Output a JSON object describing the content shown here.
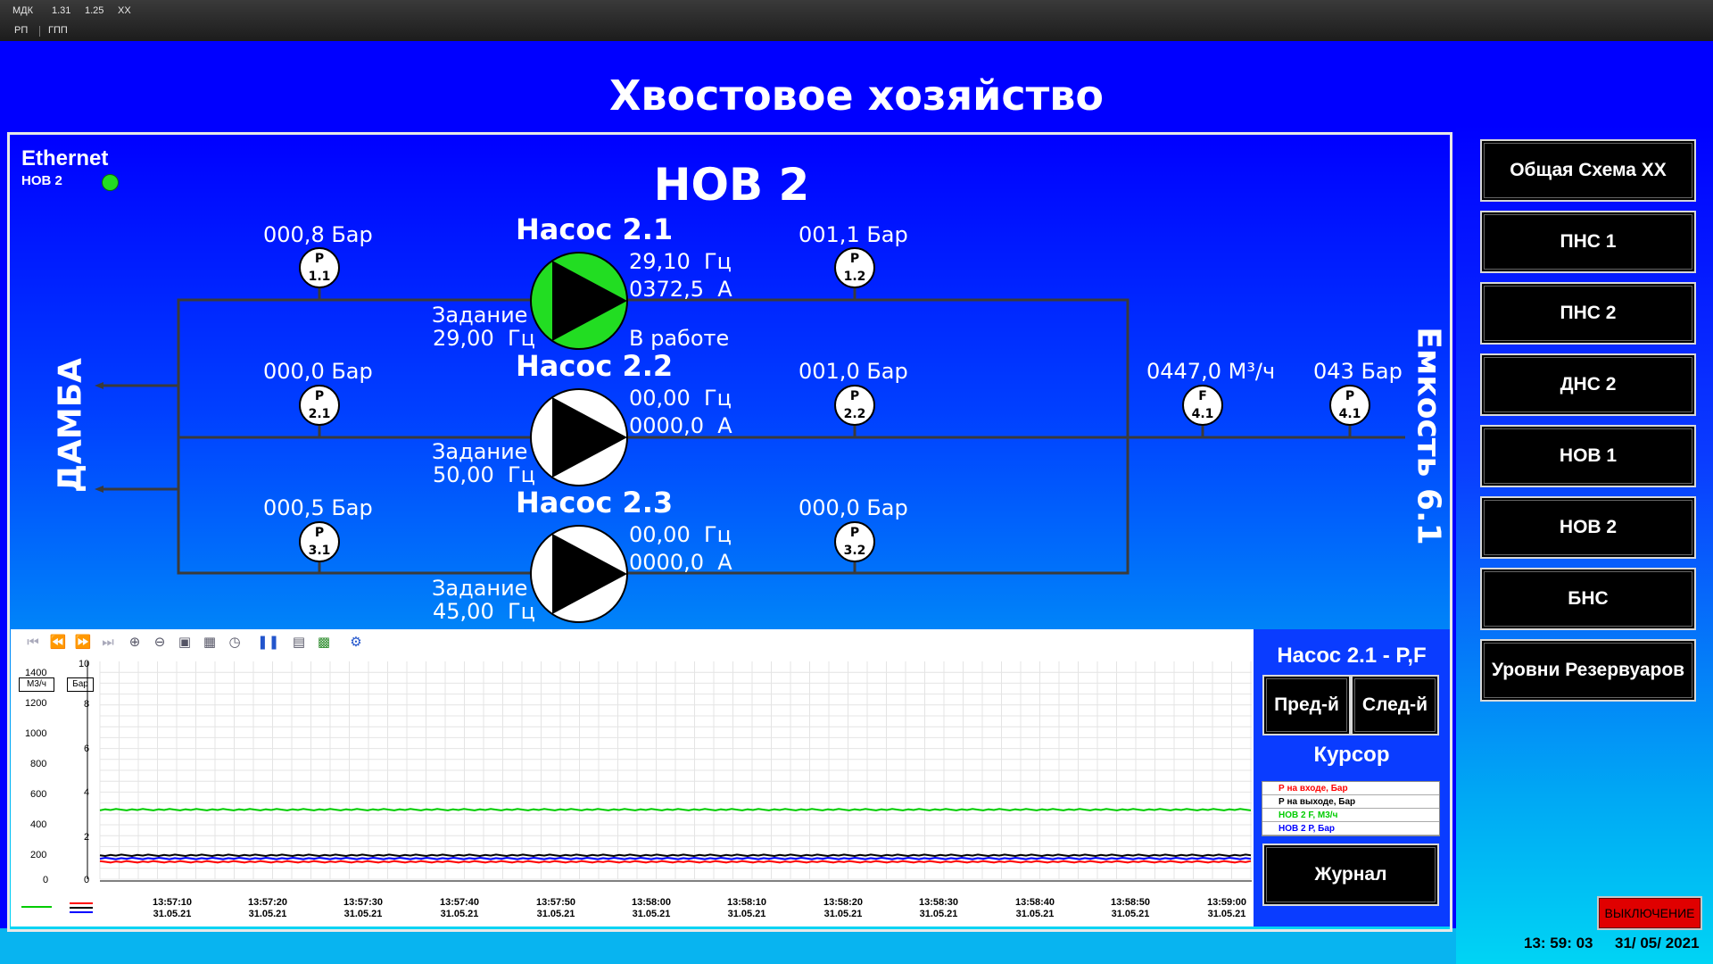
{
  "menubar": {
    "row1": [
      "МДК",
      "1.31",
      "1.25",
      "ХХ"
    ],
    "row2": [
      "РП",
      "ГПП"
    ]
  },
  "title": "Хвостовое хозяйство",
  "comm": {
    "label": "Ethernet",
    "node": "НОВ 2",
    "status_color": "#22dd22"
  },
  "station_title": "НОВ 2",
  "left_label": "ДАМБА",
  "right_label": "Емкость 6.1",
  "pumps": [
    {
      "name": "Насос 2.1",
      "freq": "29,10  Гц",
      "current": "0372,5  А",
      "setpoint_label": "Задание",
      "setpoint": "29,00  Гц",
      "state": "В работе",
      "running": true
    },
    {
      "name": "Насос 2.2",
      "freq": "00,00  Гц",
      "current": "0000,0  А",
      "setpoint_label": "Задание",
      "setpoint": "50,00  Гц",
      "state": "",
      "running": false
    },
    {
      "name": "Насос 2.3",
      "freq": "00,00  Гц",
      "current": "0000,0  А",
      "setpoint_label": "Задание",
      "setpoint": "45,00  Гц",
      "state": "",
      "running": false
    }
  ],
  "sensors": {
    "p11": {
      "letter": "P",
      "id": "1.1",
      "value": "000,8 Бар"
    },
    "p12": {
      "letter": "P",
      "id": "1.2",
      "value": "001,1 Бар"
    },
    "p21": {
      "letter": "P",
      "id": "2.1",
      "value": "000,0 Бар"
    },
    "p22": {
      "letter": "P",
      "id": "2.2",
      "value": "001,0 Бар"
    },
    "p31": {
      "letter": "P",
      "id": "3.1",
      "value": "000,5 Бар"
    },
    "p32": {
      "letter": "P",
      "id": "3.2",
      "value": "000,0 Бар"
    },
    "f41": {
      "letter": "F",
      "id": "4.1",
      "value": "0447,0 М³/ч"
    },
    "p41": {
      "letter": "P",
      "id": "4.1",
      "value": "043 Бар"
    }
  },
  "nav": [
    "Общая Схема ХХ",
    "ПНС 1",
    "ПНС 2",
    "ДНС 2",
    "НОВ 1",
    "НОВ 2",
    "БНС",
    "Уровни Резервуаров"
  ],
  "chart_panel": {
    "title": "Насос 2.1 - P,F",
    "prev": "Пред-й",
    "next": "След-й",
    "cursor": "Курсор",
    "journal": "Журнал",
    "legend": [
      {
        "label": "Р на входе, Бар",
        "color": "#ff0000"
      },
      {
        "label": "Р на выходе, Бар",
        "color": "#000000"
      },
      {
        "label": "НОВ 2 F, М3/ч",
        "color": "#00cc00"
      },
      {
        "label": "НОВ 2 Р, Бар",
        "color": "#0000ff"
      }
    ]
  },
  "shutdown": "ВЫКЛЮЧЕНИЕ",
  "clock": {
    "time": "13: 59: 03",
    "date": "31/ 05/ 2021"
  },
  "chart_data": {
    "type": "line",
    "left_axis": {
      "unit": "М3/ч",
      "ticks": [
        "1400",
        "1200",
        "1000",
        "800",
        "600",
        "400",
        "200",
        "0"
      ],
      "range": [
        0,
        1400
      ]
    },
    "right_axis": {
      "unit": "Бар",
      "ticks": [
        "10",
        "8",
        "6",
        "4",
        "2",
        "0"
      ],
      "range": [
        0,
        10
      ]
    },
    "x_ticks": [
      {
        "time": "13:57:10",
        "date": "31.05.21"
      },
      {
        "time": "13:57:20",
        "date": "31.05.21"
      },
      {
        "time": "13:57:30",
        "date": "31.05.21"
      },
      {
        "time": "13:57:40",
        "date": "31.05.21"
      },
      {
        "time": "13:57:50",
        "date": "31.05.21"
      },
      {
        "time": "13:58:00",
        "date": "31.05.21"
      },
      {
        "time": "13:58:10",
        "date": "31.05.21"
      },
      {
        "time": "13:58:20",
        "date": "31.05.21"
      },
      {
        "time": "13:58:30",
        "date": "31.05.21"
      },
      {
        "time": "13:58:40",
        "date": "31.05.21"
      },
      {
        "time": "13:58:50",
        "date": "31.05.21"
      },
      {
        "time": "13:59:00",
        "date": "31.05.21"
      }
    ],
    "series": [
      {
        "name": "НОВ 2 F, М3/ч",
        "axis": "left",
        "color": "#00cc00",
        "value": 447
      },
      {
        "name": "Р на выходе, Бар",
        "axis": "right",
        "color": "#000000",
        "value": 1.1
      },
      {
        "name": "Р на входе, Бар",
        "axis": "right",
        "color": "#ff0000",
        "value": 0.8
      },
      {
        "name": "НОВ 2 Р, Бар",
        "axis": "right",
        "color": "#0000ff",
        "value": 0.95
      }
    ]
  }
}
